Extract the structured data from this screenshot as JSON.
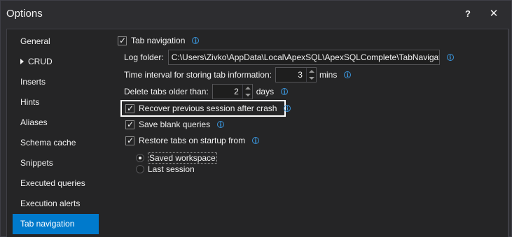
{
  "window": {
    "title": "Options",
    "help_label": "?",
    "close_label": "✕"
  },
  "sidebar": {
    "items": [
      {
        "label": "General",
        "expandable": false,
        "selected": false
      },
      {
        "label": "CRUD",
        "expandable": true,
        "selected": false
      },
      {
        "label": "Inserts",
        "expandable": false,
        "selected": false
      },
      {
        "label": "Hints",
        "expandable": false,
        "selected": false
      },
      {
        "label": "Aliases",
        "expandable": false,
        "selected": false
      },
      {
        "label": "Schema cache",
        "expandable": false,
        "selected": false
      },
      {
        "label": "Snippets",
        "expandable": false,
        "selected": false
      },
      {
        "label": "Executed queries",
        "expandable": false,
        "selected": false
      },
      {
        "label": "Execution alerts",
        "expandable": false,
        "selected": false
      },
      {
        "label": "Tab navigation",
        "expandable": false,
        "selected": true
      }
    ]
  },
  "settings": {
    "tab_navigation": {
      "label": "Tab navigation",
      "checked": true
    },
    "log_folder": {
      "label": "Log folder:",
      "value": "C:\\Users\\Zivko\\AppData\\Local\\ApexSQL\\ApexSQLComplete\\TabNavigation"
    },
    "time_interval": {
      "label": "Time interval for storing tab information:",
      "value": "3",
      "unit": "mins"
    },
    "delete_tabs": {
      "label": "Delete tabs older than:",
      "value": "2",
      "unit": "days"
    },
    "recover_session": {
      "label": "Recover previous session after crash",
      "checked": true
    },
    "save_blank": {
      "label": "Save blank queries",
      "checked": true
    },
    "restore_tabs": {
      "label": "Restore tabs on startup from",
      "checked": true
    },
    "restore_options": [
      {
        "label": "Saved workspace",
        "selected": true
      },
      {
        "label": "Last session",
        "selected": false
      }
    ]
  },
  "icons": {
    "info": "info-icon",
    "folder": "folder-icon",
    "check": "checkmark-icon"
  },
  "colors": {
    "background": "#2d2d30",
    "panel": "#252526",
    "accent": "#007acc",
    "info": "#3a96dd",
    "text": "#f1f1f1"
  }
}
